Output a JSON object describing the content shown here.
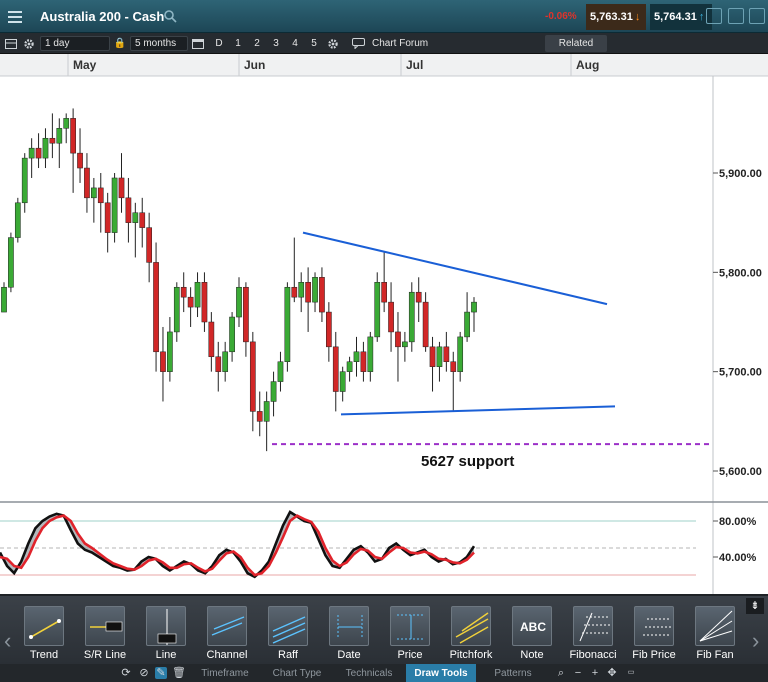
{
  "titlebar": {
    "title": "Australia 200 - Cash",
    "change_pct": "-0.06%",
    "sell_price": "5,763.31",
    "buy_price": "5,764.31"
  },
  "toolbar": {
    "interval": "1 day",
    "range": "5 months",
    "periods": [
      "D",
      "1",
      "2",
      "3",
      "4",
      "5"
    ],
    "chart_forum": "Chart Forum",
    "related": "Related"
  },
  "chart_data": {
    "type": "candlestick",
    "instrument": "Australia 200 - Cash",
    "x_month_labels": [
      "May",
      "Jun",
      "Jul",
      "Aug"
    ],
    "y_ticks": [
      "5,900.00",
      "5,800.00",
      "5,700.00",
      "5,600.00"
    ],
    "ylim": [
      5590,
      5980
    ],
    "candles": [
      [
        5760,
        5790,
        5770,
        5785
      ],
      [
        5785,
        5840,
        5780,
        5835
      ],
      [
        5835,
        5875,
        5830,
        5870
      ],
      [
        5870,
        5920,
        5860,
        5915
      ],
      [
        5915,
        5935,
        5895,
        5925
      ],
      [
        5925,
        5940,
        5905,
        5915
      ],
      [
        5915,
        5945,
        5905,
        5935
      ],
      [
        5935,
        5960,
        5915,
        5930
      ],
      [
        5930,
        5955,
        5905,
        5945
      ],
      [
        5945,
        5960,
        5930,
        5955
      ],
      [
        5955,
        5965,
        5880,
        5920
      ],
      [
        5920,
        5945,
        5890,
        5905
      ],
      [
        5905,
        5920,
        5860,
        5875
      ],
      [
        5875,
        5895,
        5850,
        5885
      ],
      [
        5885,
        5900,
        5840,
        5870
      ],
      [
        5870,
        5880,
        5820,
        5840
      ],
      [
        5840,
        5900,
        5830,
        5895
      ],
      [
        5895,
        5920,
        5860,
        5875
      ],
      [
        5875,
        5895,
        5830,
        5850
      ],
      [
        5850,
        5870,
        5815,
        5860
      ],
      [
        5860,
        5875,
        5825,
        5845
      ],
      [
        5845,
        5860,
        5790,
        5810
      ],
      [
        5810,
        5830,
        5700,
        5720
      ],
      [
        5720,
        5745,
        5670,
        5700
      ],
      [
        5700,
        5755,
        5690,
        5740
      ],
      [
        5740,
        5790,
        5730,
        5785
      ],
      [
        5785,
        5800,
        5760,
        5775
      ],
      [
        5775,
        5785,
        5745,
        5765
      ],
      [
        5765,
        5800,
        5755,
        5790
      ],
      [
        5790,
        5800,
        5740,
        5750
      ],
      [
        5750,
        5760,
        5700,
        5715
      ],
      [
        5715,
        5730,
        5680,
        5700
      ],
      [
        5700,
        5730,
        5690,
        5720
      ],
      [
        5720,
        5760,
        5710,
        5755
      ],
      [
        5755,
        5795,
        5745,
        5785
      ],
      [
        5785,
        5790,
        5715,
        5730
      ],
      [
        5730,
        5740,
        5640,
        5660
      ],
      [
        5660,
        5680,
        5635,
        5650
      ],
      [
        5650,
        5680,
        5620,
        5670
      ],
      [
        5670,
        5700,
        5655,
        5690
      ],
      [
        5690,
        5720,
        5680,
        5710
      ],
      [
        5710,
        5790,
        5700,
        5785
      ],
      [
        5785,
        5835,
        5770,
        5775
      ],
      [
        5775,
        5800,
        5760,
        5790
      ],
      [
        5790,
        5805,
        5740,
        5770
      ],
      [
        5770,
        5800,
        5760,
        5795
      ],
      [
        5795,
        5805,
        5750,
        5760
      ],
      [
        5760,
        5770,
        5710,
        5725
      ],
      [
        5725,
        5740,
        5660,
        5680
      ],
      [
        5680,
        5705,
        5670,
        5700
      ],
      [
        5700,
        5715,
        5690,
        5710
      ],
      [
        5710,
        5735,
        5695,
        5720
      ],
      [
        5720,
        5730,
        5690,
        5700
      ],
      [
        5700,
        5740,
        5690,
        5735
      ],
      [
        5735,
        5800,
        5730,
        5790
      ],
      [
        5790,
        5820,
        5760,
        5770
      ],
      [
        5770,
        5790,
        5720,
        5740
      ],
      [
        5740,
        5760,
        5690,
        5725
      ],
      [
        5725,
        5740,
        5710,
        5730
      ],
      [
        5730,
        5790,
        5720,
        5780
      ],
      [
        5780,
        5795,
        5750,
        5770
      ],
      [
        5770,
        5780,
        5720,
        5725
      ],
      [
        5725,
        5735,
        5680,
        5705
      ],
      [
        5705,
        5730,
        5690,
        5725
      ],
      [
        5725,
        5740,
        5700,
        5710
      ],
      [
        5710,
        5720,
        5660,
        5700
      ],
      [
        5700,
        5740,
        5690,
        5735
      ],
      [
        5735,
        5780,
        5730,
        5760
      ],
      [
        5760,
        5775,
        5740,
        5770
      ]
    ],
    "trendlines": [
      {
        "name": "resistance",
        "points": [
          [
            5840,
            5840
          ],
          [
            5768,
            5768
          ]
        ],
        "color": "#1a5fd6"
      },
      {
        "name": "support",
        "points": [
          [
            5657,
            5657
          ],
          [
            5665,
            5665
          ]
        ],
        "color": "#1a5fd6"
      }
    ],
    "support_level": 5627,
    "support_label": "5627 support",
    "support_color": "#9b2fc8",
    "oscillator": {
      "y_ticks": [
        "80.00%",
        "40.00%"
      ],
      "ylim": [
        0,
        100
      ],
      "fast_color": "#111111",
      "slow_color": "#e0232b",
      "fill_color": "#9aa0a6",
      "fast": [
        45,
        30,
        22,
        35,
        55,
        72,
        80,
        85,
        88,
        86,
        70,
        55,
        48,
        45,
        40,
        35,
        30,
        28,
        25,
        26,
        35,
        40,
        38,
        30,
        25,
        30,
        35,
        32,
        25,
        22,
        30,
        42,
        48,
        45,
        35,
        22,
        18,
        25,
        35,
        55,
        75,
        90,
        85,
        80,
        78,
        60,
        42,
        30,
        28,
        38,
        48,
        52,
        45,
        35,
        38,
        50,
        55,
        48,
        42,
        45,
        48,
        40,
        35,
        38,
        32,
        34,
        40,
        52
      ],
      "slow": [
        40,
        38,
        30,
        28,
        40,
        58,
        72,
        80,
        84,
        86,
        80,
        66,
        55,
        50,
        44,
        38,
        33,
        30,
        27,
        26,
        30,
        36,
        38,
        34,
        28,
        28,
        32,
        33,
        28,
        24,
        27,
        36,
        44,
        46,
        40,
        28,
        20,
        22,
        30,
        45,
        62,
        80,
        86,
        82,
        79,
        68,
        50,
        36,
        30,
        34,
        43,
        49,
        47,
        40,
        38,
        45,
        51,
        50,
        45,
        44,
        46,
        43,
        38,
        37,
        34,
        33,
        37,
        45
      ]
    }
  },
  "drawtools": {
    "tools": [
      "Trend",
      "S/R Line",
      "Line",
      "Channel",
      "Raff",
      "Date",
      "Price",
      "Pitchfork",
      "Note",
      "Fibonacci",
      "Fib Price",
      "Fib Fan"
    ]
  },
  "tabs": [
    "Timeframe",
    "Chart Type",
    "Technicals",
    "Draw Tools",
    "Patterns"
  ],
  "active_tab": "Draw Tools",
  "colors": {
    "up_candle": "#3aaa35",
    "down_candle": "#d12727",
    "header_bg": "#1d4656",
    "active_tab": "#2a7da8"
  }
}
